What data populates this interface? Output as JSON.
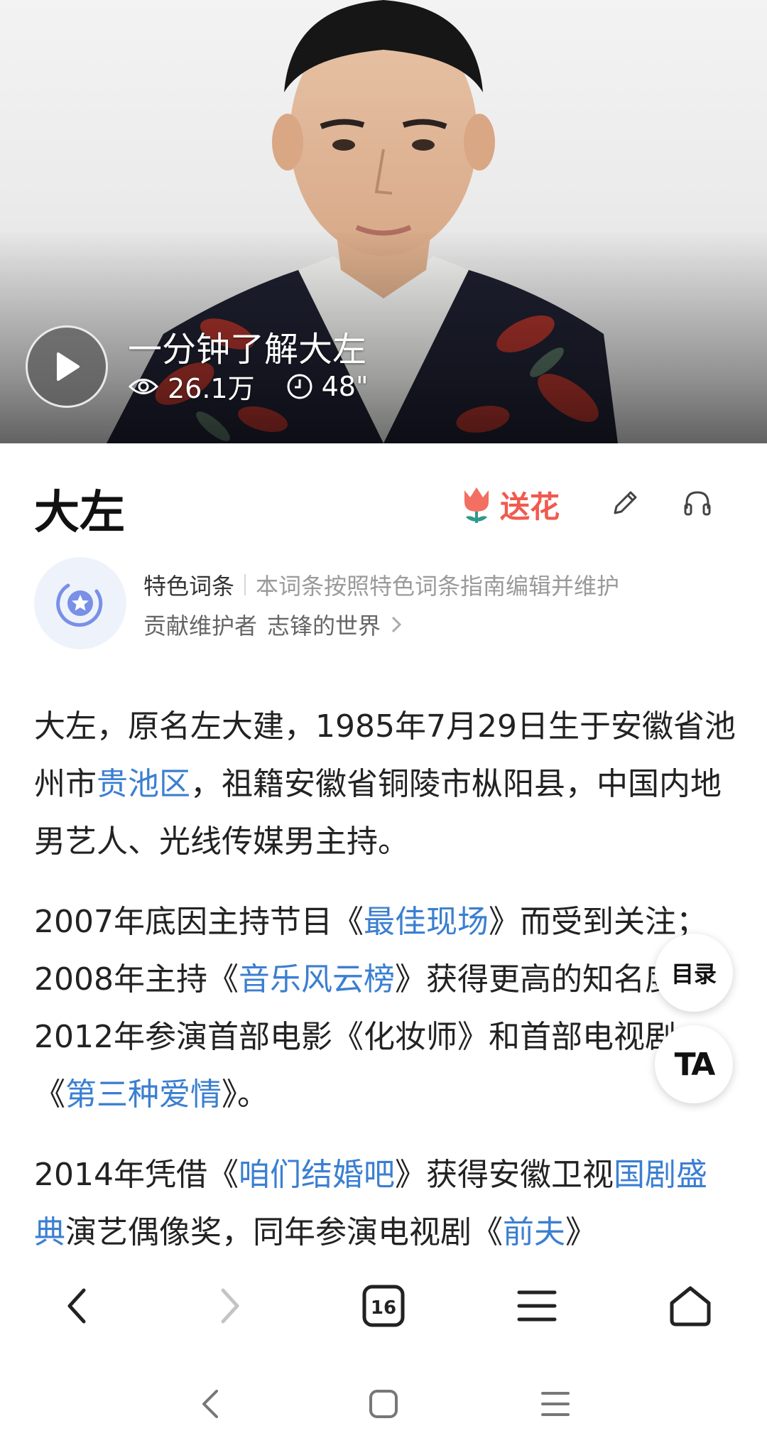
{
  "hero": {
    "video_title": "一分钟了解大左",
    "views": "26.1万",
    "duration": "48\""
  },
  "entry": {
    "title": "大左",
    "flower_label": "送花"
  },
  "featured": {
    "tag": "特色词条",
    "description": "本词条按照特色词条指南编辑并维护",
    "contributor_label": "贡献维护者",
    "contributor_name": "志锋的世界"
  },
  "article": {
    "p1": [
      "大左，原名左大建，1985年7月29日生于安徽省池州市",
      "贵池区",
      "，祖籍安徽省铜陵市枞阳县，中国内地男艺人、光线传媒男主持。"
    ],
    "p2": [
      "2007年底因主持节目《",
      "最佳现场",
      "》而受到关注；2008年主持《",
      "音乐风云榜",
      "》获得更高的知名度；2012年参演首部电影《化妆师》和首部电视剧《",
      "第三种爱情",
      "》。"
    ],
    "p3": [
      "2014年凭借《",
      "咱们结婚吧",
      "》获得安徽卫视",
      "国剧盛典",
      "演艺偶像奖，同年参演电视剧《",
      "前夫",
      "》"
    ]
  },
  "floating": {
    "toc_label": "目录",
    "ta_label": "TA"
  },
  "toolbar": {
    "tab_count": "16"
  },
  "colors": {
    "link": "#3b7fd1",
    "flower": "#f15a4f",
    "featured_icon": "#7a8fe6"
  },
  "icons": {
    "play": "play-icon",
    "views": "eye-icon",
    "duration": "clock-icon",
    "flower": "tulip-icon",
    "edit": "pencil-icon",
    "listen": "headphones-icon",
    "featured": "star-badge-icon",
    "contributor_more": "chevron-right-icon",
    "back": "chevron-left-icon",
    "forward": "chevron-right-icon",
    "tabs": "tabs-icon",
    "menu": "menu-icon",
    "home": "home-icon"
  }
}
